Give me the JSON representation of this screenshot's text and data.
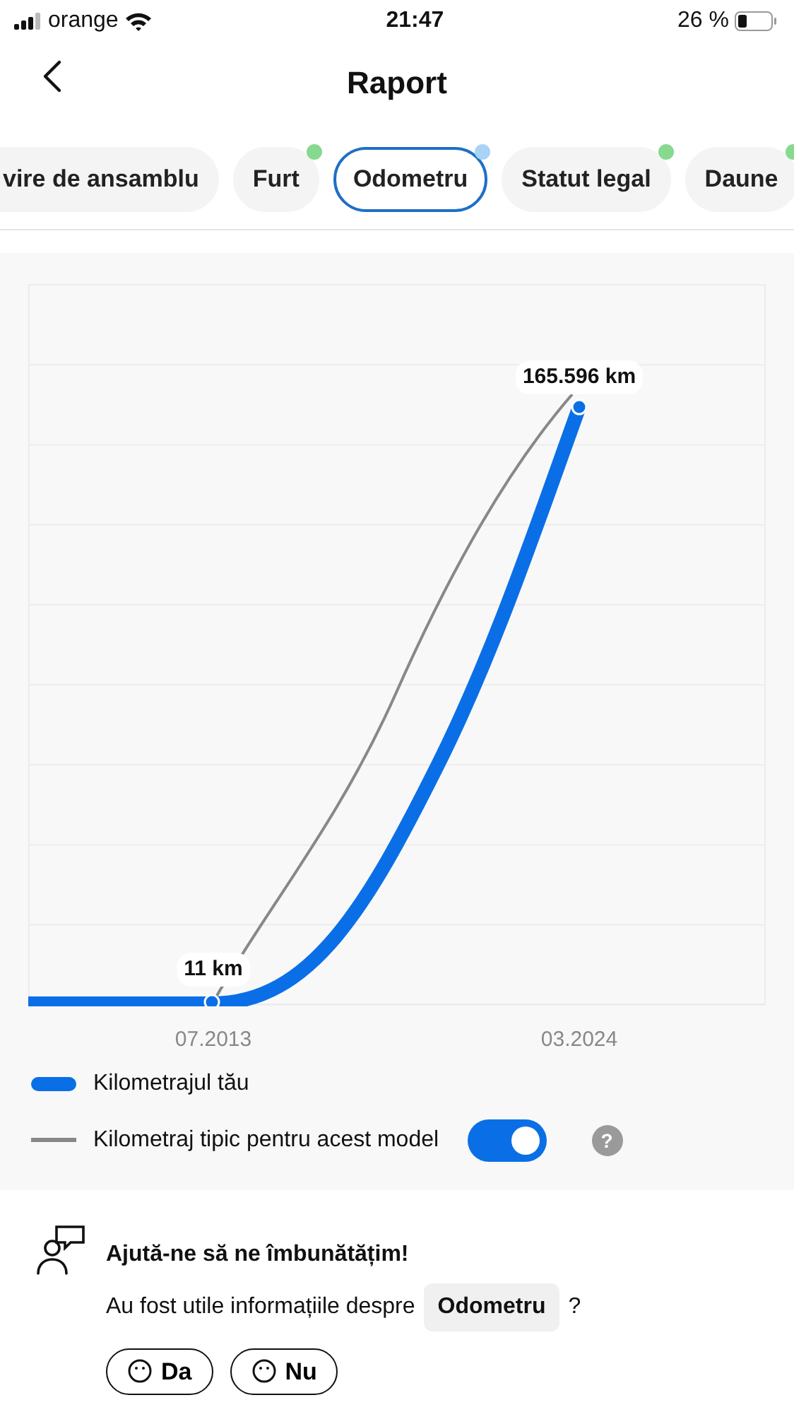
{
  "status_bar": {
    "carrier": "orange",
    "time": "21:47",
    "battery": "26 %"
  },
  "header": {
    "title": "Raport"
  },
  "tabs": [
    {
      "label": "vire de ansamblu",
      "selected": false
    },
    {
      "label": "Furt",
      "selected": false,
      "color": "#86d98f"
    },
    {
      "label": "Odometru",
      "selected": true,
      "color": "#a9d3f5"
    },
    {
      "label": "Statut legal",
      "selected": false,
      "color": "#86d98f"
    },
    {
      "label": "Daune",
      "selected": false,
      "color": "#86d98f"
    }
  ],
  "chart": {
    "point_labels": [
      "11 km",
      "165.596 km"
    ],
    "x_labels": [
      "07.2013",
      "03.2024"
    ]
  },
  "legend": [
    {
      "kind": "thick",
      "label": "Kilometrajul tău"
    },
    {
      "kind": "thin",
      "label": "Kilometraj tipic pentru acest model",
      "toggle": {
        "on": true
      },
      "help": "?"
    }
  ],
  "feedback": {
    "title": "Ajută-ne să ne îmbunătățim!",
    "question": "Au fost utile informațiile despre",
    "topic": "Odometru",
    "question_end": "?",
    "buttons": [
      "Da",
      "Nu"
    ]
  }
}
